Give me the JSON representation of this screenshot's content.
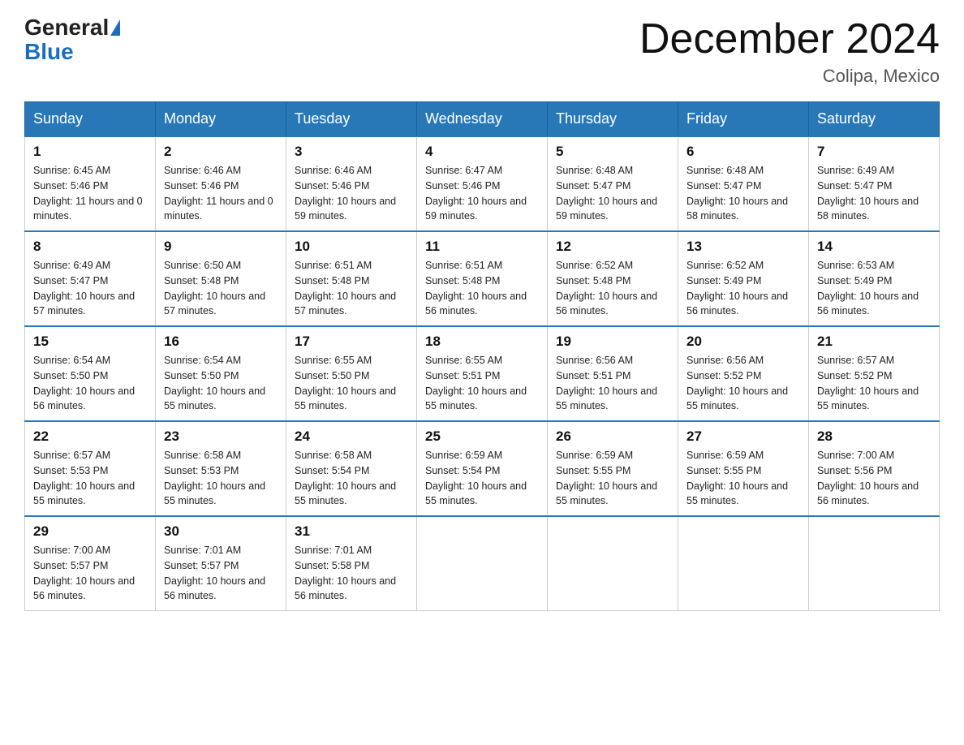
{
  "header": {
    "logo_general": "General",
    "logo_blue": "Blue",
    "month_title": "December 2024",
    "location": "Colipa, Mexico"
  },
  "days_of_week": [
    "Sunday",
    "Monday",
    "Tuesday",
    "Wednesday",
    "Thursday",
    "Friday",
    "Saturday"
  ],
  "weeks": [
    [
      {
        "day": "1",
        "sunrise": "6:45 AM",
        "sunset": "5:46 PM",
        "daylight": "11 hours and 0 minutes."
      },
      {
        "day": "2",
        "sunrise": "6:46 AM",
        "sunset": "5:46 PM",
        "daylight": "11 hours and 0 minutes."
      },
      {
        "day": "3",
        "sunrise": "6:46 AM",
        "sunset": "5:46 PM",
        "daylight": "10 hours and 59 minutes."
      },
      {
        "day": "4",
        "sunrise": "6:47 AM",
        "sunset": "5:46 PM",
        "daylight": "10 hours and 59 minutes."
      },
      {
        "day": "5",
        "sunrise": "6:48 AM",
        "sunset": "5:47 PM",
        "daylight": "10 hours and 59 minutes."
      },
      {
        "day": "6",
        "sunrise": "6:48 AM",
        "sunset": "5:47 PM",
        "daylight": "10 hours and 58 minutes."
      },
      {
        "day": "7",
        "sunrise": "6:49 AM",
        "sunset": "5:47 PM",
        "daylight": "10 hours and 58 minutes."
      }
    ],
    [
      {
        "day": "8",
        "sunrise": "6:49 AM",
        "sunset": "5:47 PM",
        "daylight": "10 hours and 57 minutes."
      },
      {
        "day": "9",
        "sunrise": "6:50 AM",
        "sunset": "5:48 PM",
        "daylight": "10 hours and 57 minutes."
      },
      {
        "day": "10",
        "sunrise": "6:51 AM",
        "sunset": "5:48 PM",
        "daylight": "10 hours and 57 minutes."
      },
      {
        "day": "11",
        "sunrise": "6:51 AM",
        "sunset": "5:48 PM",
        "daylight": "10 hours and 56 minutes."
      },
      {
        "day": "12",
        "sunrise": "6:52 AM",
        "sunset": "5:48 PM",
        "daylight": "10 hours and 56 minutes."
      },
      {
        "day": "13",
        "sunrise": "6:52 AM",
        "sunset": "5:49 PM",
        "daylight": "10 hours and 56 minutes."
      },
      {
        "day": "14",
        "sunrise": "6:53 AM",
        "sunset": "5:49 PM",
        "daylight": "10 hours and 56 minutes."
      }
    ],
    [
      {
        "day": "15",
        "sunrise": "6:54 AM",
        "sunset": "5:50 PM",
        "daylight": "10 hours and 56 minutes."
      },
      {
        "day": "16",
        "sunrise": "6:54 AM",
        "sunset": "5:50 PM",
        "daylight": "10 hours and 55 minutes."
      },
      {
        "day": "17",
        "sunrise": "6:55 AM",
        "sunset": "5:50 PM",
        "daylight": "10 hours and 55 minutes."
      },
      {
        "day": "18",
        "sunrise": "6:55 AM",
        "sunset": "5:51 PM",
        "daylight": "10 hours and 55 minutes."
      },
      {
        "day": "19",
        "sunrise": "6:56 AM",
        "sunset": "5:51 PM",
        "daylight": "10 hours and 55 minutes."
      },
      {
        "day": "20",
        "sunrise": "6:56 AM",
        "sunset": "5:52 PM",
        "daylight": "10 hours and 55 minutes."
      },
      {
        "day": "21",
        "sunrise": "6:57 AM",
        "sunset": "5:52 PM",
        "daylight": "10 hours and 55 minutes."
      }
    ],
    [
      {
        "day": "22",
        "sunrise": "6:57 AM",
        "sunset": "5:53 PM",
        "daylight": "10 hours and 55 minutes."
      },
      {
        "day": "23",
        "sunrise": "6:58 AM",
        "sunset": "5:53 PM",
        "daylight": "10 hours and 55 minutes."
      },
      {
        "day": "24",
        "sunrise": "6:58 AM",
        "sunset": "5:54 PM",
        "daylight": "10 hours and 55 minutes."
      },
      {
        "day": "25",
        "sunrise": "6:59 AM",
        "sunset": "5:54 PM",
        "daylight": "10 hours and 55 minutes."
      },
      {
        "day": "26",
        "sunrise": "6:59 AM",
        "sunset": "5:55 PM",
        "daylight": "10 hours and 55 minutes."
      },
      {
        "day": "27",
        "sunrise": "6:59 AM",
        "sunset": "5:55 PM",
        "daylight": "10 hours and 55 minutes."
      },
      {
        "day": "28",
        "sunrise": "7:00 AM",
        "sunset": "5:56 PM",
        "daylight": "10 hours and 56 minutes."
      }
    ],
    [
      {
        "day": "29",
        "sunrise": "7:00 AM",
        "sunset": "5:57 PM",
        "daylight": "10 hours and 56 minutes."
      },
      {
        "day": "30",
        "sunrise": "7:01 AM",
        "sunset": "5:57 PM",
        "daylight": "10 hours and 56 minutes."
      },
      {
        "day": "31",
        "sunrise": "7:01 AM",
        "sunset": "5:58 PM",
        "daylight": "10 hours and 56 minutes."
      },
      null,
      null,
      null,
      null
    ]
  ],
  "labels": {
    "sunrise_prefix": "Sunrise: ",
    "sunset_prefix": "Sunset: ",
    "daylight_prefix": "Daylight: "
  }
}
